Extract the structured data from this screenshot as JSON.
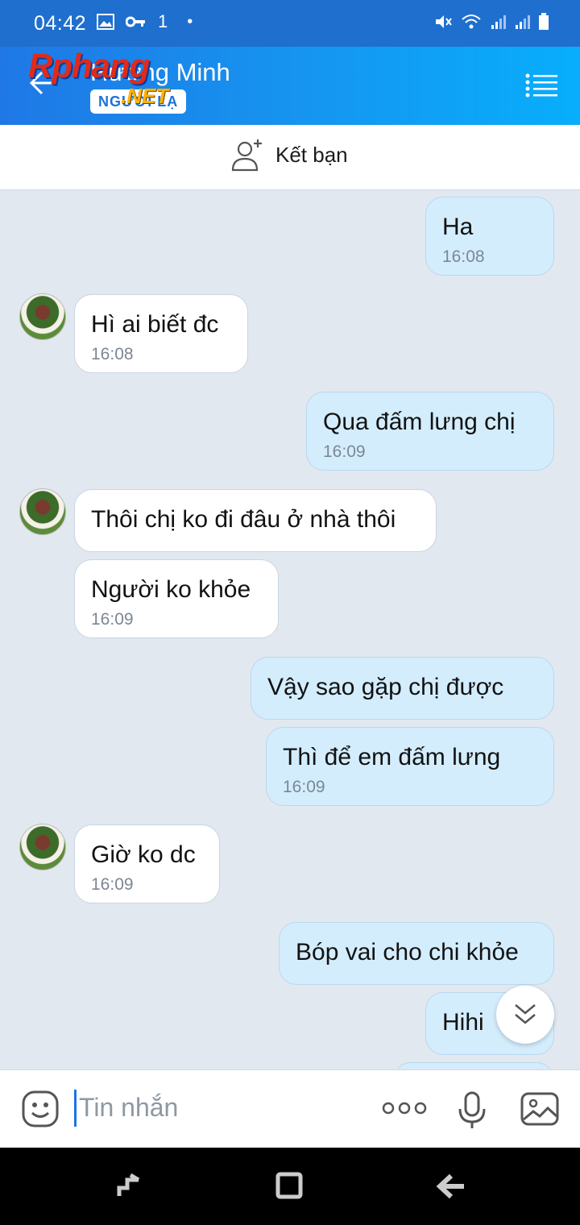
{
  "status_bar": {
    "time": "04:42",
    "signal_label": "1"
  },
  "header": {
    "contact_name": "Hương Minh",
    "badge": "NGƯỜI LẠ",
    "watermark": "Rphang",
    "watermark_suffix": ".NET"
  },
  "friend_bar": {
    "label": "Kết bạn"
  },
  "messages": [
    {
      "side": "out",
      "text": "Ha",
      "time": "16:08"
    },
    {
      "side": "in",
      "text": "Hì ai biết đc",
      "time": "16:08"
    },
    {
      "side": "out",
      "text": "Qua đấm lưng  chị",
      "time": "16:09"
    },
    {
      "side": "in",
      "text": "Thôi chị ko đi đâu ở nhà thôi",
      "time": ""
    },
    {
      "side": "in",
      "text": "Người ko khỏe",
      "time": "16:09"
    },
    {
      "side": "out",
      "text": "Vậy  sao gặp  chị  được",
      "time": ""
    },
    {
      "side": "out",
      "text": "Thì  để  em đấm  lưng",
      "time": "16:09"
    },
    {
      "side": "in",
      "text": "Giờ ko dc",
      "time": "16:09"
    },
    {
      "side": "out",
      "text": "Bóp vai cho chi khỏe",
      "time": ""
    },
    {
      "side": "out",
      "text": "Hihi",
      "time": ""
    }
  ],
  "input": {
    "placeholder": "Tin nhắn"
  },
  "colors": {
    "header_start": "#1f78e6",
    "header_end": "#08aefc",
    "bubble_out": "#d3edfd",
    "bubble_in": "#ffffff",
    "chat_bg": "#e2e8ef"
  }
}
